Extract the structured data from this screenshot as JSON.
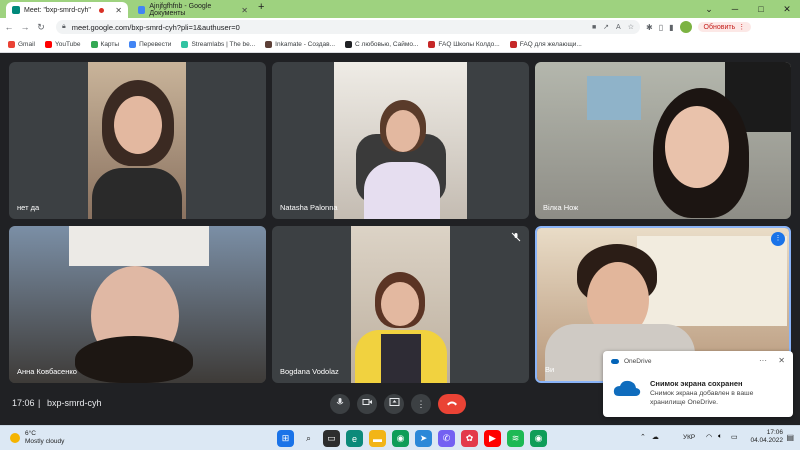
{
  "tabs": [
    {
      "title": "Meet: \"bxp-smrd-cyh\"",
      "active": true
    },
    {
      "title": "Ajnjfgfhfnb - Google Документы",
      "active": false
    }
  ],
  "address": {
    "url": "meet.google.com/bxp-smrd-cyh?pli=1&authuser=0"
  },
  "toolbar": {
    "update_label": "Обновить"
  },
  "bookmarks": [
    {
      "label": "Gmail",
      "color": "#ea4335"
    },
    {
      "label": "YouTube",
      "color": "#ff0000"
    },
    {
      "label": "Карты",
      "color": "#34a853"
    },
    {
      "label": "Перевести",
      "color": "#4285f4"
    },
    {
      "label": "Streamlabs | The be...",
      "color": "#31c3a2"
    },
    {
      "label": "Inkamate - Создав...",
      "color": "#5d4037"
    },
    {
      "label": "С любовью, Саймо...",
      "color": "#202124"
    },
    {
      "label": "FAQ Школы Колдо...",
      "color": "#c62828"
    },
    {
      "label": "FAQ для желающи...",
      "color": "#c62828"
    }
  ],
  "participants": [
    {
      "name": "нет да",
      "muted": false
    },
    {
      "name": "Natasha Palonna",
      "muted": false
    },
    {
      "name": "Вілка Нож",
      "muted": false
    },
    {
      "name": "Анна Ковбасенко",
      "muted": false
    },
    {
      "name": "Bogdana Vodolaz",
      "muted": true
    },
    {
      "name": "Ви",
      "muted": false
    }
  ],
  "meeting": {
    "time": "17:06",
    "separator": "|",
    "code": "bxp-smrd-cyh"
  },
  "controls": [
    "mic-icon",
    "camera-icon",
    "present-icon",
    "more-icon",
    "hangup-icon"
  ],
  "toast": {
    "app": "OneDrive",
    "title": "Снимок экрана сохранен",
    "body": "Снимок экрана добавлен в ваше хранилище OneDrive."
  },
  "taskbar": {
    "weather_temp": "6°C",
    "weather_desc": "Mostly cloudy",
    "language": "УКР",
    "time": "17:06",
    "date": "04.04.2022"
  },
  "colors": {
    "accent": "#1a73e8",
    "hangup": "#ea4335",
    "tabstrip": "#9ed27f",
    "stage": "#202124"
  }
}
